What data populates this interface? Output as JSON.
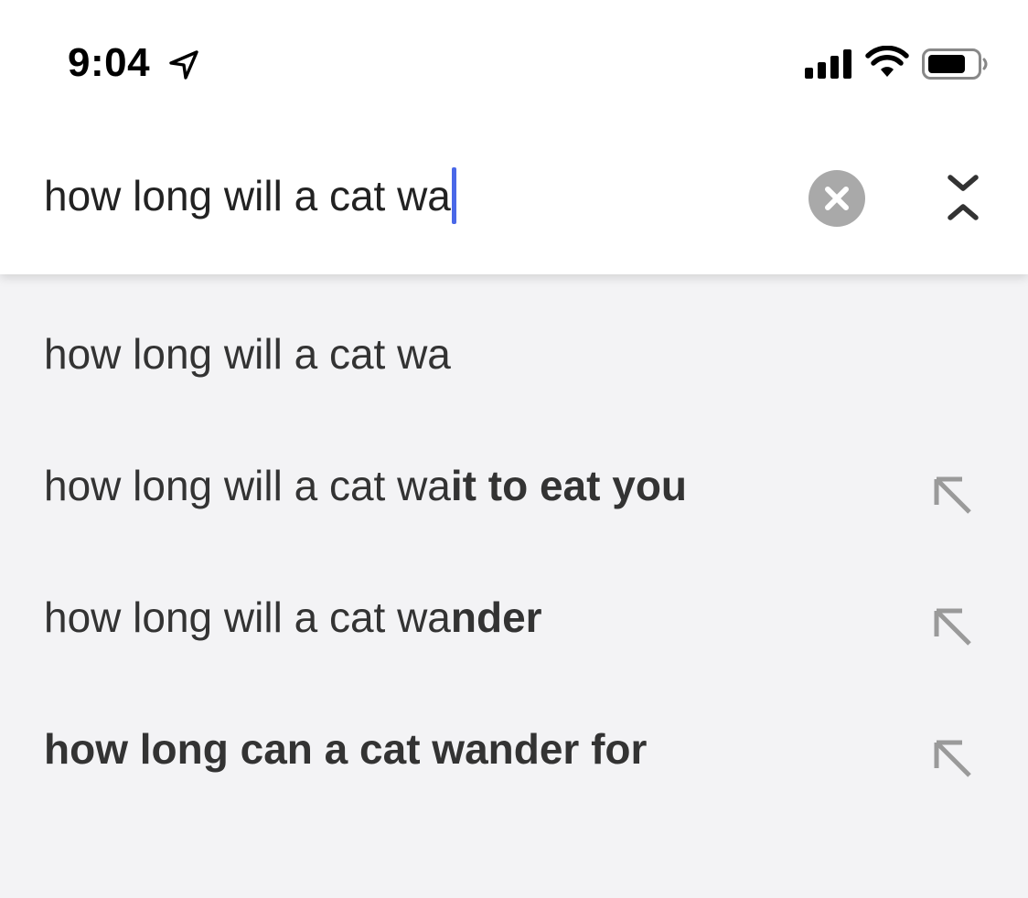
{
  "status_bar": {
    "time": "9:04",
    "icons": [
      "location-arrow-icon",
      "cellular-signal-icon",
      "wifi-icon",
      "battery-icon"
    ]
  },
  "search": {
    "query": "how long will a cat wa",
    "clear_icon": "clear-circle-icon",
    "collapse_icon": "collapse-chevrons-icon"
  },
  "suggestions": [
    {
      "typed": "how long will a cat wa",
      "completion": "",
      "bold_prefix": "",
      "has_fill_arrow": false
    },
    {
      "typed": "how long will a cat wa",
      "completion": "it to eat you",
      "bold_prefix": "",
      "has_fill_arrow": true
    },
    {
      "typed": "how long will a cat wa",
      "completion": "nder",
      "bold_prefix": "",
      "has_fill_arrow": true
    },
    {
      "typed": "",
      "completion": "",
      "bold_prefix": "how long can a cat wander for",
      "has_fill_arrow": true
    }
  ],
  "colors": {
    "caret": "#4a68e8",
    "suggestion_background": "#f3f3f5",
    "clear_button": "#a9a9a9",
    "arrow": "#9a9a9a"
  }
}
